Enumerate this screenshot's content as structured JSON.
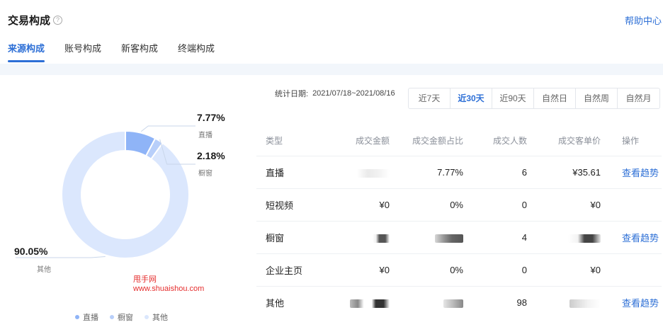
{
  "header": {
    "title": "交易构成",
    "help_link": "帮助中心"
  },
  "tabs": [
    {
      "label": "来源构成",
      "active": true
    },
    {
      "label": "账号构成",
      "active": false
    },
    {
      "label": "新客构成",
      "active": false
    },
    {
      "label": "终端构成",
      "active": false
    }
  ],
  "chart_data": {
    "type": "pie",
    "categories": [
      "直播",
      "橱窗",
      "其他"
    ],
    "values": [
      7.77,
      2.18,
      90.05
    ],
    "labels": [
      "7.77%",
      "2.18%",
      "90.05%"
    ],
    "colors": [
      "#8fb4f7",
      "#b8cffa",
      "#dbe7fd"
    ],
    "legend_position": "bottom"
  },
  "watermark": {
    "line1": "甩手网",
    "line2": "www.shuaishou.com"
  },
  "filter": {
    "date_label": "统计日期:",
    "date_range": "2021/07/18~2021/08/16",
    "ranges": [
      {
        "label": "近7天",
        "active": false
      },
      {
        "label": "近30天",
        "active": true
      },
      {
        "label": "近90天",
        "active": false
      },
      {
        "label": "自然日",
        "active": false
      },
      {
        "label": "自然周",
        "active": false
      },
      {
        "label": "自然月",
        "active": false
      }
    ]
  },
  "table": {
    "headers": [
      "类型",
      "成交金额",
      "成交金额占比",
      "成交人数",
      "成交客单价",
      "操作"
    ],
    "rows": [
      {
        "type": "直播",
        "amount": "",
        "ratio": "7.77%",
        "buyers": "6",
        "unit_price": "¥35.61",
        "action": "查看趋势"
      },
      {
        "type": "短视频",
        "amount": "¥0",
        "ratio": "0%",
        "buyers": "0",
        "unit_price": "¥0",
        "action": ""
      },
      {
        "type": "橱窗",
        "amount": "",
        "ratio": "",
        "buyers": "4",
        "unit_price": "",
        "action": "查看趋势"
      },
      {
        "type": "企业主页",
        "amount": "¥0",
        "ratio": "0%",
        "buyers": "0",
        "unit_price": "¥0",
        "action": ""
      },
      {
        "type": "其他",
        "amount": "",
        "ratio": "",
        "buyers": "98",
        "unit_price": "",
        "action": "查看趋势"
      }
    ]
  }
}
